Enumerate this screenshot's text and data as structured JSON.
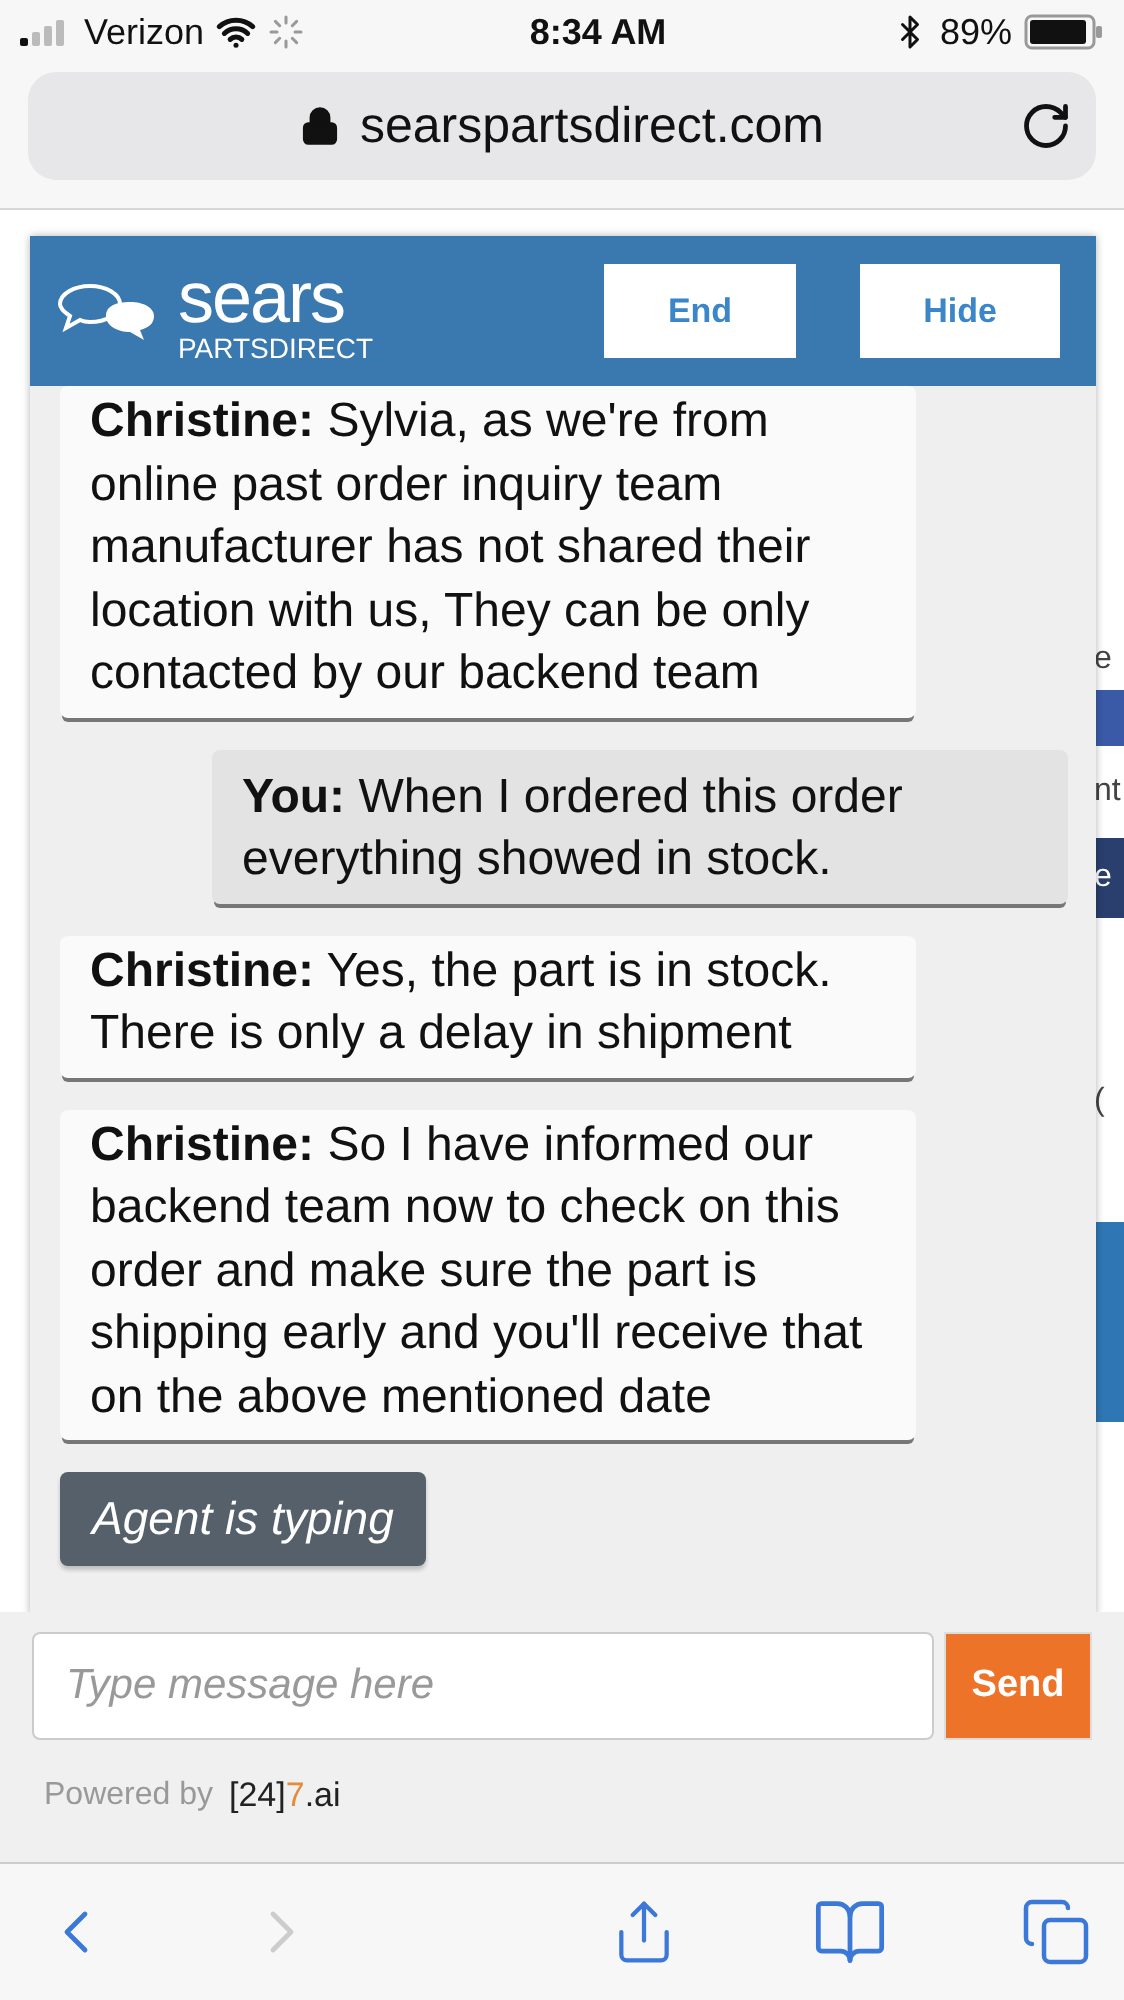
{
  "status_bar": {
    "carrier": "Verizon",
    "time": "8:34 AM",
    "battery": "89%"
  },
  "address_bar": {
    "url": "searspartsdirect.com"
  },
  "page": {
    "edge_fragments": [
      "e",
      "nt",
      "e",
      "("
    ]
  },
  "chat": {
    "logo": {
      "name": "sears",
      "tagline": "PARTSDIRECT"
    },
    "buttons": [
      "End",
      "Hide"
    ],
    "messages": [
      {
        "sender": "Christine:",
        "text": "Sylvia, as we're from online past order inquiry team manufacturer has not shared their location with us, They can be only contacted by our backend team",
        "kind": "agent"
      },
      {
        "sender": "You:",
        "text": "When I ordered this order everything showed in stock.",
        "kind": "user"
      },
      {
        "sender": "Christine:",
        "text": "Yes, the part is in stock. There is only a delay in shipment",
        "kind": "agent"
      },
      {
        "sender": "Christine:",
        "text": "So I have informed our backend team now to check on this order and make sure the part is shipping early and you'll receive that on the above mentioned date",
        "kind": "agent"
      }
    ],
    "typing": "Agent is typing",
    "input": {
      "placeholder": "Type message here"
    },
    "send": "Send",
    "powered_by": "Powered by",
    "brand": {
      "before": "[24]",
      "accent": "7",
      "after": ".ai"
    }
  }
}
